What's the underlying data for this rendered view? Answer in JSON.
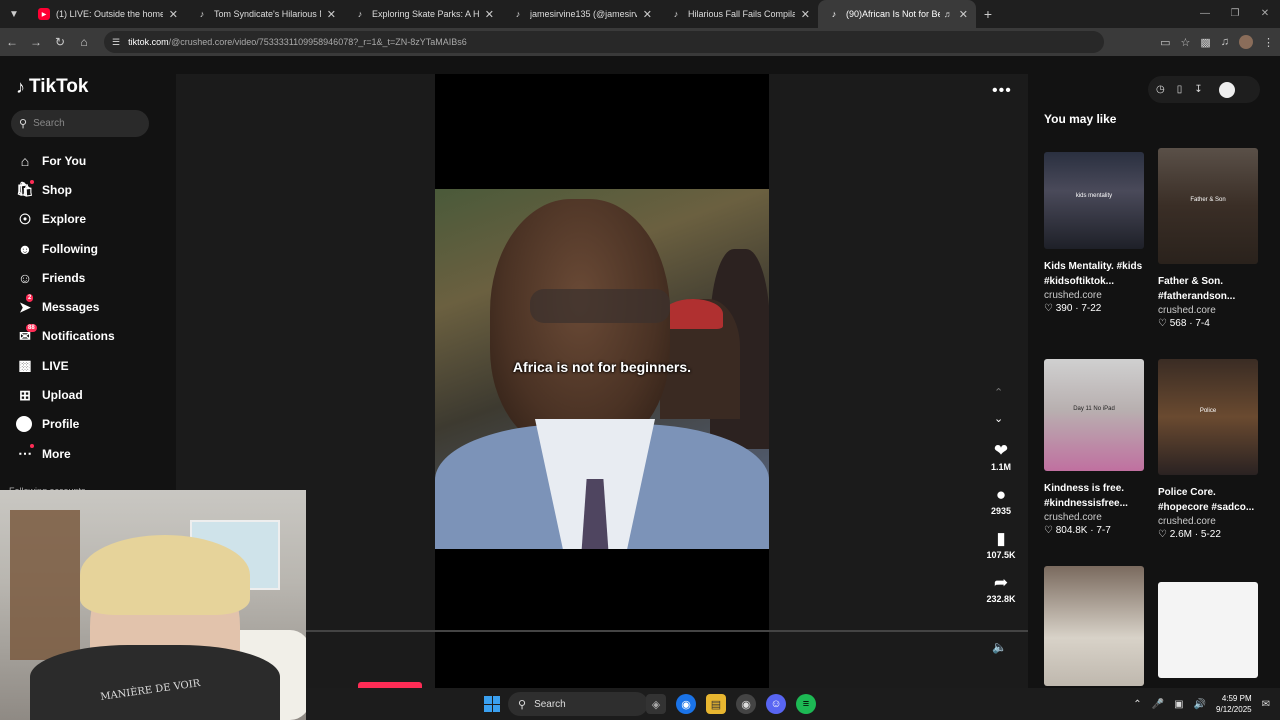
{
  "browser": {
    "tabs": [
      {
        "title": "(1) LIVE: Outside the home of th",
        "favicon": "youtube-icon"
      },
      {
        "title": "Tom Syndicate's Hilarious Mang",
        "favicon": "tiktok-icon"
      },
      {
        "title": "Exploring Skate Parks: A Histor",
        "favicon": "tiktok-icon"
      },
      {
        "title": "jamesirvine135 (@jamesirvine1",
        "favicon": "tiktok-icon"
      },
      {
        "title": "Hilarious Fall Fails Compilation",
        "favicon": "tiktok-icon"
      },
      {
        "title": "(90)African Is Not for Begin",
        "favicon": "tiktok-icon",
        "active": true
      }
    ],
    "url_host": "tiktok.com",
    "url_path": "/@crushed.core/video/7533331109958946078?_r=1&_t=ZN-8zYTaMAIBs6"
  },
  "sidebar": {
    "logo": "TikTok",
    "search_placeholder": "Search",
    "items": [
      {
        "label": "For You",
        "icon": "home-icon"
      },
      {
        "label": "Shop",
        "icon": "shop-icon",
        "dot": true
      },
      {
        "label": "Explore",
        "icon": "compass-icon"
      },
      {
        "label": "Following",
        "icon": "following-icon"
      },
      {
        "label": "Friends",
        "icon": "friends-icon"
      },
      {
        "label": "Messages",
        "icon": "messages-icon",
        "badge": "2"
      },
      {
        "label": "Notifications",
        "icon": "bell-icon",
        "badge": "88"
      },
      {
        "label": "LIVE",
        "icon": "live-icon"
      },
      {
        "label": "Upload",
        "icon": "upload-icon"
      },
      {
        "label": "Profile",
        "icon": "profile-icon"
      },
      {
        "label": "More",
        "icon": "more-icon",
        "dot": true
      }
    ],
    "following_accounts": "Following accounts"
  },
  "video": {
    "caption": "Africa is not for beginners.",
    "likes": "1.1M",
    "comments": "2935",
    "saves": "107.5K",
    "shares": "232.8K"
  },
  "recommendations": {
    "heading": "You may like",
    "cards": [
      {
        "title": "Kids Mentality. #kids #kidsoftiktok...",
        "author": "crushed.core",
        "likes": "390",
        "date": "7-22",
        "thumb_text": "kids mentality"
      },
      {
        "title": "Father & Son. #fatherandson...",
        "author": "crushed.core",
        "likes": "568",
        "date": "7-4",
        "thumb_text": "Father & Son"
      },
      {
        "title": "Kindness is free. #kindnessisfree...",
        "author": "crushed.core",
        "likes": "804.8K",
        "date": "7-7",
        "thumb_text": "Day 11 No iPad"
      },
      {
        "title": "Police Core. #hopecore #sadco...",
        "author": "crushed.core",
        "likes": "2.6M",
        "date": "5-22",
        "thumb_text": "Police"
      },
      {
        "title": "",
        "author": "",
        "likes": "",
        "date": "",
        "thumb_text": ""
      },
      {
        "title": "",
        "author": "",
        "likes": "",
        "date": "",
        "thumb_text": ""
      }
    ]
  },
  "webcam": {
    "shirt_text": "MANIÈRE DE VOIR"
  },
  "taskbar": {
    "search_label": "Search",
    "time": "4:59 PM",
    "date": "9/12/2025"
  },
  "colors": {
    "accent": "#fe2c55",
    "page_bg": "#121212",
    "browser_bg": "#1f1f1f"
  }
}
